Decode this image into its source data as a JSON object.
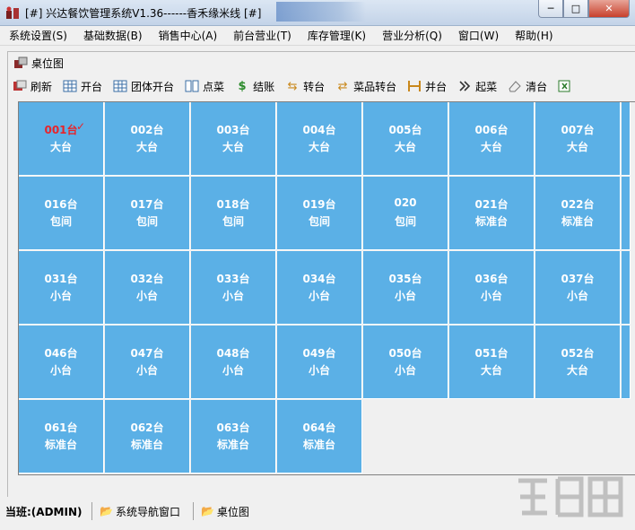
{
  "window": {
    "title": "[#] 兴达餐饮管理系统V1.36------香禾缘米线 [#]",
    "controls": {
      "minimize": "─",
      "maximize": "□",
      "close": "✕"
    }
  },
  "menubar": [
    "系统设置(S)",
    "基础数据(B)",
    "销售中心(A)",
    "前台营业(T)",
    "库存管理(K)",
    "营业分析(Q)",
    "窗口(W)",
    "帮助(H)"
  ],
  "child_window": {
    "title": "桌位图"
  },
  "toolbar": [
    {
      "label": "刷新",
      "icon": "refresh-icon"
    },
    {
      "label": "开台",
      "icon": "open-table-icon"
    },
    {
      "label": "团体开台",
      "icon": "group-open-icon"
    },
    {
      "label": "点菜",
      "icon": "order-icon"
    },
    {
      "label": "结账",
      "icon": "checkout-icon"
    },
    {
      "label": "转台",
      "icon": "transfer-icon"
    },
    {
      "label": "菜品转台",
      "icon": "dish-transfer-icon"
    },
    {
      "label": "并台",
      "icon": "merge-icon"
    },
    {
      "label": "起菜",
      "icon": "serve-icon"
    },
    {
      "label": "清台",
      "icon": "clear-icon"
    }
  ],
  "tables": [
    [
      {
        "num": "001台",
        "type": "大台",
        "occupied": true
      },
      {
        "num": "002台",
        "type": "大台"
      },
      {
        "num": "003台",
        "type": "大台"
      },
      {
        "num": "004台",
        "type": "大台"
      },
      {
        "num": "005台",
        "type": "大台"
      },
      {
        "num": "006台",
        "type": "大台"
      },
      {
        "num": "007台",
        "type": "大台"
      }
    ],
    [
      {
        "num": "016台",
        "type": "包间"
      },
      {
        "num": "017台",
        "type": "包间"
      },
      {
        "num": "018台",
        "type": "包间"
      },
      {
        "num": "019台",
        "type": "包间"
      },
      {
        "num": "020",
        "type": "包间"
      },
      {
        "num": "021台",
        "type": "标准台"
      },
      {
        "num": "022台",
        "type": "标准台"
      }
    ],
    [
      {
        "num": "031台",
        "type": "小台"
      },
      {
        "num": "032台",
        "type": "小台"
      },
      {
        "num": "033台",
        "type": "小台"
      },
      {
        "num": "034台",
        "type": "小台"
      },
      {
        "num": "035台",
        "type": "小台"
      },
      {
        "num": "036台",
        "type": "小台"
      },
      {
        "num": "037台",
        "type": "小台"
      }
    ],
    [
      {
        "num": "046台",
        "type": "小台"
      },
      {
        "num": "047台",
        "type": "小台"
      },
      {
        "num": "048台",
        "type": "小台"
      },
      {
        "num": "049台",
        "type": "小台"
      },
      {
        "num": "050台",
        "type": "小台"
      },
      {
        "num": "051台",
        "type": "大台"
      },
      {
        "num": "052台",
        "type": "大台"
      }
    ],
    [
      {
        "num": "061台",
        "type": "标准台"
      },
      {
        "num": "062台",
        "type": "标准台"
      },
      {
        "num": "063台",
        "type": "标准台"
      },
      {
        "num": "064台",
        "type": "标准台"
      }
    ]
  ],
  "statusbar": {
    "user": "当班:(ADMIN)",
    "nav_window": "系统导航窗口",
    "table_map": "桌位图"
  },
  "colors": {
    "tile": "#5bb0e6",
    "occupied": "#e8242a"
  }
}
